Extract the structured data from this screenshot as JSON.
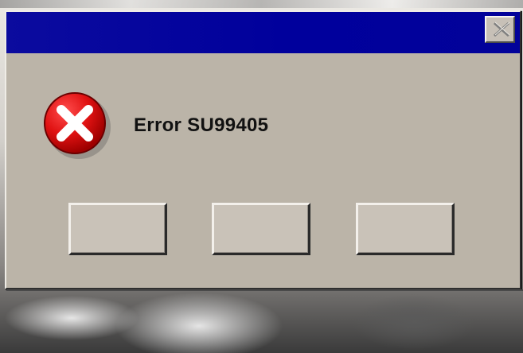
{
  "dialog": {
    "title": "",
    "message": "Error SU99405",
    "buttons": [
      {
        "label": ""
      },
      {
        "label": ""
      },
      {
        "label": ""
      }
    ],
    "icons": {
      "error": "error-icon",
      "close": "close-icon"
    }
  },
  "colors": {
    "titlebar": "#00009C",
    "window": "#BBB4A8",
    "button": "#C9C2B8",
    "error_red": "#D20A0A",
    "text": "#111111"
  }
}
